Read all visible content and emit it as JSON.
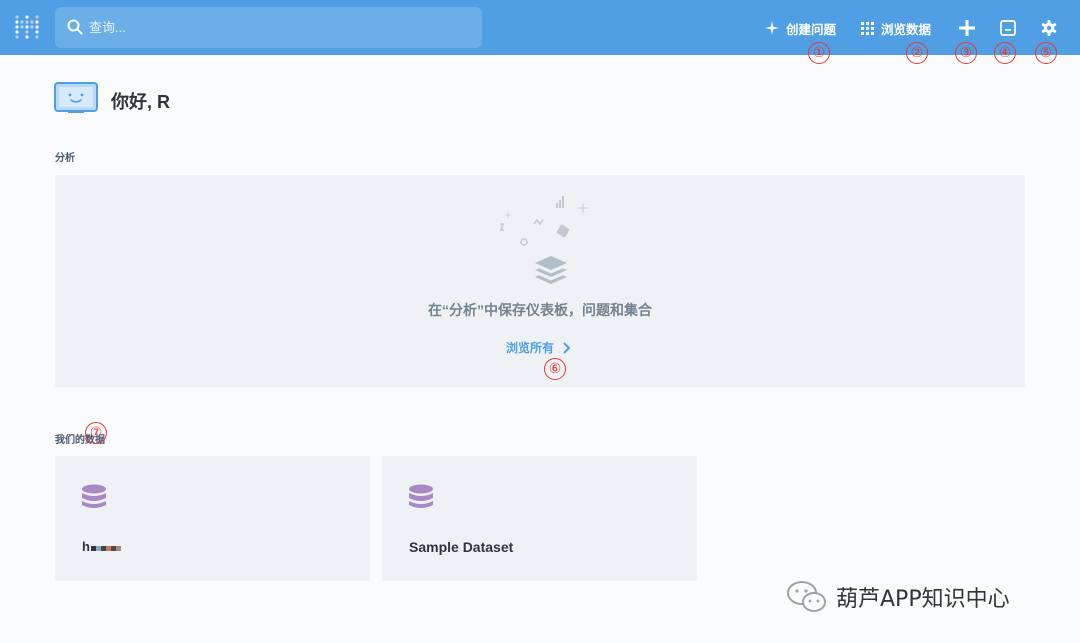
{
  "topbar": {
    "search_placeholder": "查询...",
    "new_question_label": "创建问题",
    "browse_data_label": "浏览数据"
  },
  "markers": [
    "①",
    "②",
    "③",
    "④",
    "⑤",
    "⑥",
    "⑦"
  ],
  "greeting": "你好, R",
  "analytics": {
    "section_label": "分析",
    "empty_message": "在“分析”中保存仪表板，问题和集合",
    "browse_all_label": "浏览所有"
  },
  "databases": {
    "section_label": "我们的数据",
    "items": [
      {
        "name": "h"
      },
      {
        "name": "Sample Dataset"
      }
    ]
  },
  "watermark": {
    "text": "葫芦APP知识中心"
  },
  "colors": {
    "brand": "#509ee3",
    "database_icon": "#a989c5",
    "annotation": "#e53935"
  }
}
